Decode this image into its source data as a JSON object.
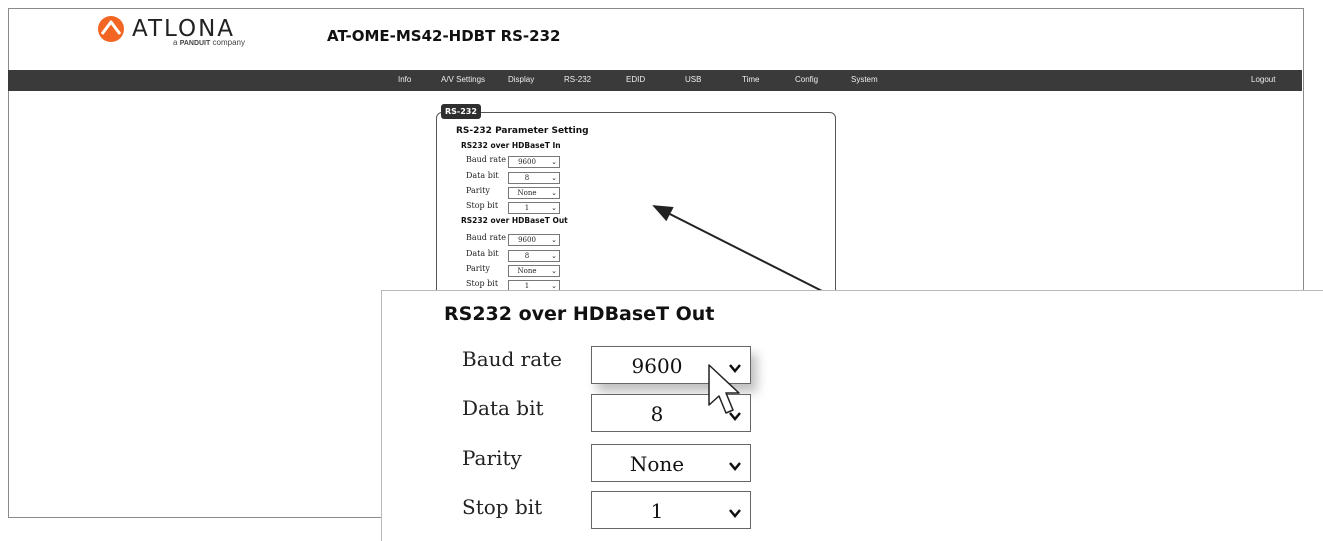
{
  "brand": {
    "name": "ATLONA",
    "tagline_a": "a",
    "tagline_brand": "PANDUIT",
    "tagline_rest": "company",
    "accent": "#f26522"
  },
  "page_title": "AT-OME-MS42-HDBT  RS-232",
  "nav": {
    "items": [
      "Info",
      "A/V Settings",
      "Display",
      "RS-232",
      "EDID",
      "USB",
      "Time",
      "Config",
      "System"
    ],
    "logout": "Logout"
  },
  "panel": {
    "tab": "RS-232",
    "title": "RS-232 Parameter Setting",
    "in_section": {
      "heading": "RS232 over HDBaseT In",
      "rows": [
        {
          "label": "Baud rate",
          "value": "9600"
        },
        {
          "label": "Data bit",
          "value": "8"
        },
        {
          "label": "Parity",
          "value": "None"
        },
        {
          "label": "Stop bit",
          "value": "1"
        }
      ]
    },
    "out_section": {
      "heading": "RS232 over HDBaseT Out",
      "rows": [
        {
          "label": "Baud rate",
          "value": "9600"
        },
        {
          "label": "Data bit",
          "value": "8"
        },
        {
          "label": "Parity",
          "value": "None"
        },
        {
          "label": "Stop bit",
          "value": "1"
        }
      ]
    }
  },
  "zoom": {
    "heading": "RS232 over HDBaseT Out",
    "rows": [
      {
        "label": "Baud rate",
        "value": "9600"
      },
      {
        "label": "Data bit",
        "value": "8"
      },
      {
        "label": "Parity",
        "value": "None"
      },
      {
        "label": "Stop bit",
        "value": "1"
      }
    ]
  },
  "icons": {
    "dropdown": "chevron-down-icon",
    "cursor": "mouse-pointer-icon",
    "callout": "arrow-icon"
  }
}
